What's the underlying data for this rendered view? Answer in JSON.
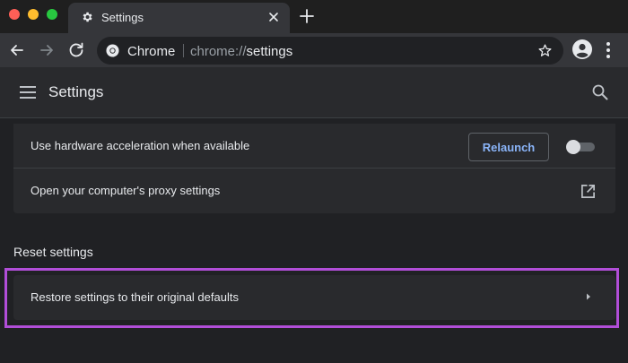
{
  "browser": {
    "tab": {
      "title": "Settings",
      "icon": "gear-icon"
    },
    "omnibox": {
      "site_label": "Chrome",
      "url_scheme": "chrome://",
      "url_host": "settings"
    }
  },
  "header": {
    "title": "Settings"
  },
  "system_section": {
    "rows": [
      {
        "label": "Use hardware acceleration when available",
        "button_label": "Relaunch",
        "toggle_on": false
      },
      {
        "label": "Open your computer's proxy settings"
      }
    ]
  },
  "reset_section": {
    "title": "Reset settings",
    "rows": [
      {
        "label": "Restore settings to their original defaults"
      }
    ]
  },
  "colors": {
    "highlight": "#b14ed8",
    "accent": "#8ab4f8"
  }
}
